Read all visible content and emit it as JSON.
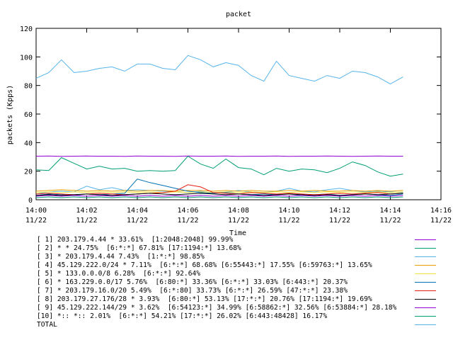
{
  "chart_data": {
    "type": "line",
    "title": "packet",
    "xlabel": "Time",
    "ylabel": "packets (Kpps)",
    "ylim": [
      0,
      120
    ],
    "yticks": [
      "0",
      "20",
      "40",
      "60",
      "80",
      "100",
      "120"
    ],
    "xticks": [
      {
        "time": "14:00",
        "date": "11/22"
      },
      {
        "time": "14:02",
        "date": "11/22"
      },
      {
        "time": "14:04",
        "date": "11/22"
      },
      {
        "time": "14:06",
        "date": "11/22"
      },
      {
        "time": "14:08",
        "date": "11/22"
      },
      {
        "time": "14:10",
        "date": "11/22"
      },
      {
        "time": "14:12",
        "date": "11/22"
      },
      {
        "time": "14:14",
        "date": "11/22"
      },
      {
        "time": "14:16",
        "date": "11/22"
      }
    ],
    "xlim_minutes": [
      0,
      16
    ],
    "grid": false,
    "legend_position": "bottom",
    "series": [
      {
        "name": "[ 1] 203.179.4.44 * 33.61%  [1:2048:2048] 99.99%",
        "color": "#9400d3",
        "x": [
          0,
          0.5,
          1,
          1.5,
          2,
          2.5,
          3,
          3.5,
          4,
          4.5,
          5,
          5.5,
          6,
          6.5,
          7,
          7.5,
          8,
          8.5,
          9,
          9.5,
          10,
          10.5,
          11,
          11.5,
          12,
          12.5,
          13,
          13.5,
          14,
          14.5
        ],
        "values": [
          30.5,
          30.6,
          30.4,
          30.5,
          30.6,
          30.5,
          30.5,
          30.4,
          30.6,
          30.5,
          30.5,
          30.4,
          30.6,
          30.5,
          30.5,
          30.6,
          30.4,
          30.5,
          30.5,
          30.6,
          30.4,
          30.5,
          30.5,
          30.6,
          30.5,
          30.4,
          30.5,
          30.6,
          30.5,
          30.5
        ]
      },
      {
        "name": "[ 2] * * 24.75%  [6:*:*] 67.81% [17:1194:*] 13.68%",
        "color": "#009e73",
        "x": [
          0,
          0.5,
          1,
          1.5,
          2,
          2.5,
          3,
          3.5,
          4,
          4.5,
          5,
          5.5,
          6,
          6.5,
          7,
          7.5,
          8,
          8.5,
          9,
          9.5,
          10,
          10.5,
          11,
          11.5,
          12,
          12.5,
          13,
          13.5,
          14,
          14.5
        ],
        "values": [
          21,
          20.5,
          29.5,
          25.5,
          21.5,
          23.5,
          21.5,
          22,
          20,
          20.5,
          20,
          20.5,
          30.5,
          25,
          22,
          28.5,
          22.5,
          21.5,
          17.5,
          22,
          20,
          21.5,
          21,
          19,
          22,
          26.5,
          24,
          19.5,
          16.5,
          18
        ]
      },
      {
        "name": "[ 3] * 203.179.4.44 7.43%  [1:*:*] 98.85%",
        "color": "#56b4e9",
        "x": [
          0,
          0.5,
          1,
          1.5,
          2,
          2.5,
          3,
          3.5,
          4,
          4.5,
          5,
          5.5,
          6,
          6.5,
          7,
          7.5,
          8,
          8.5,
          9,
          9.5,
          10,
          10.5,
          11,
          11.5,
          12,
          12.5,
          13,
          13.5,
          14,
          14.5
        ],
        "values": [
          4,
          5.5,
          6,
          5.5,
          9.5,
          7,
          8.5,
          6.5,
          7,
          6.5,
          6,
          5.5,
          5,
          6,
          4.5,
          5.5,
          6.5,
          5.5,
          5,
          6,
          8,
          6,
          5.5,
          7,
          8,
          6.5,
          5.5,
          6,
          5.5,
          5
        ]
      },
      {
        "name": "[ 4] 45.129.222.0/24 * 7.11%  [6:*:*] 68.68% [6:55443:*] 17.55% [6:59763:*] 13.65%",
        "color": "#e69f00",
        "x": [
          0,
          0.5,
          1,
          1.5,
          2,
          2.5,
          3,
          3.5,
          4,
          4.5,
          5,
          5.5,
          6,
          6.5,
          7,
          7.5,
          8,
          8.5,
          9,
          9.5,
          10,
          10.5,
          11,
          11.5,
          12,
          12.5,
          13,
          13.5,
          14,
          14.5
        ],
        "values": [
          6,
          6.5,
          7,
          6.5,
          6,
          6.5,
          6,
          6.5,
          6,
          6.5,
          6.5,
          6,
          6.5,
          6.5,
          6,
          6.5,
          6,
          6.5,
          6,
          6,
          6.5,
          6,
          6.5,
          6,
          6,
          6.5,
          6,
          6.5,
          6,
          6.5
        ]
      },
      {
        "name": "[ 5] * 133.0.0.0/8 6.28%  [6:*:*] 92.64%",
        "color": "#f0e442",
        "x": [
          0,
          0.5,
          1,
          1.5,
          2,
          2.5,
          3,
          3.5,
          4,
          4.5,
          5,
          5.5,
          6,
          6.5,
          7,
          7.5,
          8,
          8.5,
          9,
          9.5,
          10,
          10.5,
          11,
          11.5,
          12,
          12.5,
          13,
          13.5,
          14,
          14.5
        ],
        "values": [
          5,
          5.5,
          5,
          5.5,
          5,
          5.5,
          5,
          5.5,
          5,
          5.5,
          5,
          5.5,
          5,
          5.5,
          5,
          5.5,
          5,
          5.5,
          5,
          5.5,
          5,
          5.5,
          5,
          5.5,
          5,
          5.5,
          5,
          5.5,
          5,
          5.5
        ]
      },
      {
        "name": "[ 6] * 163.229.0.0/17 5.76%  [6:80:*] 33.36% [6:*:*] 33.03% [6:443:*] 20.37%",
        "color": "#0072b2",
        "x": [
          0,
          0.5,
          1,
          1.5,
          2,
          2.5,
          3,
          3.5,
          4,
          4.5,
          5,
          5.5,
          6,
          6.5,
          7,
          7.5,
          8,
          8.5,
          9,
          9.5,
          10,
          10.5,
          11,
          11.5,
          12,
          12.5,
          13,
          13.5,
          14,
          14.5
        ],
        "values": [
          3,
          4,
          3.5,
          3,
          4,
          3.5,
          4,
          4.5,
          14.5,
          12,
          10,
          8,
          6,
          5,
          4.5,
          5,
          4,
          3.5,
          4,
          3.5,
          4,
          3,
          3.5,
          4,
          3,
          3.5,
          4,
          3.5,
          3,
          4
        ]
      },
      {
        "name": "[ 7] * 203.179.16.0/20 5.49%  [6:*:80] 33.73% [6:*:*] 26.59% [47:*:*] 23.38%",
        "color": "#e51e10",
        "x": [
          0,
          0.5,
          1,
          1.5,
          2,
          2.5,
          3,
          3.5,
          4,
          4.5,
          5,
          5.5,
          6,
          6.5,
          7,
          7.5,
          8,
          8.5,
          9,
          9.5,
          10,
          10.5,
          11,
          11.5,
          12,
          12.5,
          13,
          13.5,
          14,
          14.5
        ],
        "values": [
          4,
          4.5,
          4,
          3.5,
          4,
          4.5,
          4,
          3.5,
          4,
          4.5,
          5,
          6,
          10.5,
          9,
          5,
          4.5,
          4,
          5,
          4.5,
          4,
          4.5,
          4,
          3.5,
          4,
          4.5,
          4,
          4.5,
          5,
          4,
          4.5
        ]
      },
      {
        "name": "[ 8] 203.179.27.176/28 * 3.93%  [6:80:*] 53.13% [17:*:*] 20.76% [17:1194:*] 19.69%",
        "color": "#000000",
        "x": [
          0,
          0.5,
          1,
          1.5,
          2,
          2.5,
          3,
          3.5,
          4,
          4.5,
          5,
          5.5,
          6,
          6.5,
          7,
          7.5,
          8,
          8.5,
          9,
          9.5,
          10,
          10.5,
          11,
          11.5,
          12,
          12.5,
          13,
          13.5,
          14,
          14.5
        ],
        "values": [
          3,
          3.5,
          3,
          3.5,
          4,
          3.5,
          3,
          3.5,
          4,
          4.5,
          4,
          3.5,
          4,
          4.5,
          4,
          3.5,
          4,
          3.5,
          3,
          3.5,
          4,
          3.5,
          3,
          3.5,
          3,
          3.5,
          4,
          3.5,
          4,
          4.5
        ]
      },
      {
        "name": "[ 9] 45.129.222.144/29 * 3.62%  [6:54123:*] 34.99% [6:58862:*] 32.56% [6:53884:*] 28.18%",
        "color": "#9400d3",
        "x": [
          0,
          0.5,
          1,
          1.5,
          2,
          2.5,
          3,
          3.5,
          4,
          4.5,
          5,
          5.5,
          6,
          6.5,
          7,
          7.5,
          8,
          8.5,
          9,
          9.5,
          10,
          10.5,
          11,
          11.5,
          12,
          12.5,
          13,
          13.5,
          14,
          14.5
        ],
        "values": [
          2.5,
          3,
          2.5,
          3,
          2.5,
          3,
          2.5,
          3,
          2.5,
          3,
          2.5,
          3,
          2.5,
          3,
          2.5,
          3,
          2.5,
          3,
          2.5,
          3,
          2.5,
          3,
          2.5,
          3,
          2.5,
          3,
          2.5,
          3,
          2.5,
          3
        ]
      },
      {
        "name": "[10] *:: *:: 2.01%  [6:*:*] 54.21% [17:*:*] 26.02% [6:443:48428] 16.17%",
        "color": "#009e73",
        "x": [
          0,
          0.5,
          1,
          1.5,
          2,
          2.5,
          3,
          3.5,
          4,
          4.5,
          5,
          5.5,
          6,
          6.5,
          7,
          7.5,
          8,
          8.5,
          9,
          9.5,
          10,
          10.5,
          11,
          11.5,
          12,
          12.5,
          13,
          13.5,
          14,
          14.5
        ],
        "values": [
          1.5,
          2,
          1.5,
          2,
          1.5,
          2,
          1.5,
          2,
          1.5,
          2,
          1.5,
          2,
          1.5,
          2,
          1.5,
          2,
          1.5,
          2,
          1.5,
          2,
          1.5,
          2,
          1.5,
          2,
          1.5,
          2,
          1.5,
          2,
          1.5,
          2
        ]
      },
      {
        "name": "TOTAL",
        "color": "#56b4e9",
        "x": [
          0,
          0.5,
          1,
          1.5,
          2,
          2.5,
          3,
          3.5,
          4,
          4.5,
          5,
          5.5,
          6,
          6.5,
          7,
          7.5,
          8,
          8.5,
          9,
          9.5,
          10,
          10.5,
          11,
          11.5,
          12,
          12.5,
          13,
          13.5,
          14,
          14.5
        ],
        "values": [
          85,
          89,
          98,
          89,
          90,
          92,
          93,
          90,
          95,
          95,
          92,
          91,
          101,
          98,
          93,
          96,
          94,
          87,
          83,
          97,
          87,
          85,
          83,
          87,
          85,
          90,
          89,
          86,
          81,
          86
        ]
      }
    ]
  }
}
